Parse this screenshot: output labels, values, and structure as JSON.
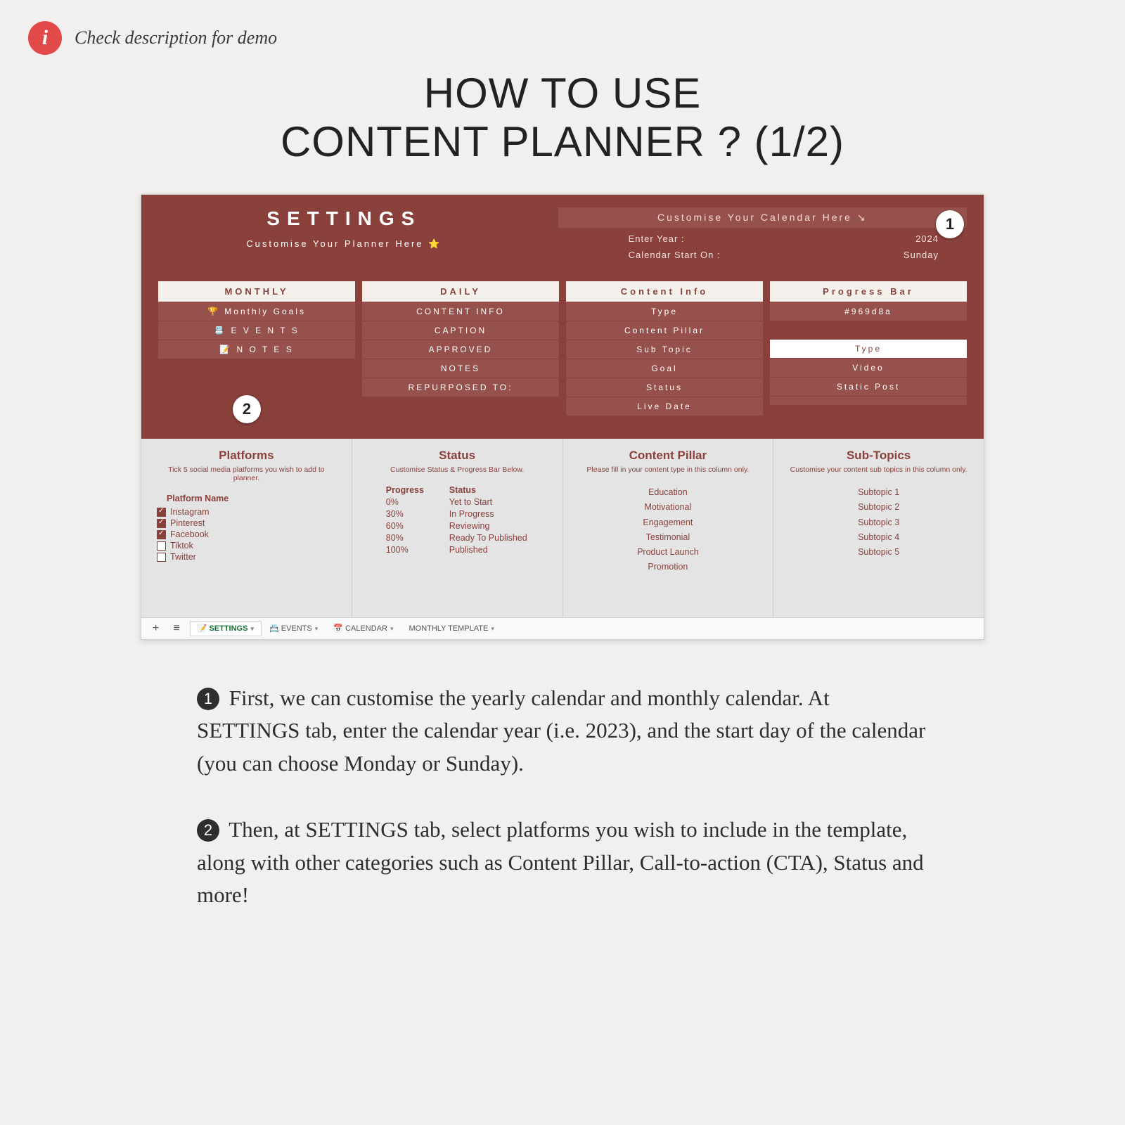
{
  "topInfo": "Check description for demo",
  "title_l1": "HOW TO USE",
  "title_l2": "CONTENT PLANNER ?  (1/2)",
  "sheet": {
    "settingsTitle": "SETTINGS",
    "settingsSub": "Customise Your Planner Here ⭐",
    "calHeader": "Customise Your Calendar Here ↘",
    "calRows": [
      {
        "label": "Enter Year :",
        "value": "2024"
      },
      {
        "label": "Calendar Start On :",
        "value": "Sunday"
      }
    ],
    "callout1": "1",
    "callout2": "2",
    "cols": {
      "monthly": {
        "head": "MONTHLY",
        "items": [
          "🏆 Monthly Goals",
          "📇 E V E N T S",
          "📝 N O T E S"
        ]
      },
      "daily": {
        "head": "DAILY",
        "items": [
          "CONTENT INFO",
          "CAPTION",
          "APPROVED",
          "NOTES",
          "REPURPOSED TO:"
        ]
      },
      "info": {
        "head": "Content Info",
        "items": [
          "Type",
          "Content Pillar",
          "Sub Topic",
          "Goal",
          "Status",
          "Live Date"
        ]
      },
      "progress": {
        "head": "Progress Bar",
        "code": "#969d8a",
        "typeHead": "Type",
        "items": [
          "Video",
          "Static Post",
          ""
        ]
      }
    },
    "lower": {
      "platforms": {
        "title": "Platforms",
        "sub": "Tick 5 social media platforms you wish to add to planner.",
        "colhead": "Platform Name",
        "items": [
          {
            "name": "Instagram",
            "checked": true
          },
          {
            "name": "Pinterest",
            "checked": true
          },
          {
            "name": "Facebook",
            "checked": true
          },
          {
            "name": "Tiktok",
            "checked": false
          },
          {
            "name": "Twitter",
            "checked": false
          }
        ]
      },
      "status": {
        "title": "Status",
        "sub": "Customise Status & Progress Bar Below.",
        "head1": "Progress",
        "head2": "Status",
        "rows": [
          {
            "p": "0%",
            "s": "Yet to Start"
          },
          {
            "p": "30%",
            "s": "In Progress"
          },
          {
            "p": "60%",
            "s": "Reviewing"
          },
          {
            "p": "80%",
            "s": "Ready To Published"
          },
          {
            "p": "100%",
            "s": "Published"
          }
        ]
      },
      "pillar": {
        "title": "Content Pillar",
        "sub": "Please fill in your content type in this column only.",
        "items": [
          "Education",
          "Motivational",
          "Engagement",
          "Testimonial",
          "Product Launch",
          "Promotion"
        ]
      },
      "subtopics": {
        "title": "Sub-Topics",
        "sub": "Customise your content sub topics in this column only.",
        "items": [
          "Subtopic 1",
          "Subtopic 2",
          "Subtopic 3",
          "Subtopic 4",
          "Subtopic 5"
        ]
      }
    },
    "tabs": [
      {
        "label": "📝 SETTINGS",
        "active": true
      },
      {
        "label": "📇 EVENTS",
        "active": false
      },
      {
        "label": "📅 CALENDAR",
        "active": false
      },
      {
        "label": "MONTHLY TEMPLATE",
        "active": false
      }
    ]
  },
  "instructions": {
    "n1": "1",
    "p1": "First, we can customise the yearly calendar and monthly calendar. At SETTINGS tab, enter the calendar year (i.e. 2023), and the start day of the calendar (you can choose Monday or Sunday).",
    "n2": "2",
    "p2": "Then, at SETTINGS tab, select platforms you wish to include in the template, along with other categories such as Content Pillar, Call-to-action (CTA), Status and more!"
  }
}
